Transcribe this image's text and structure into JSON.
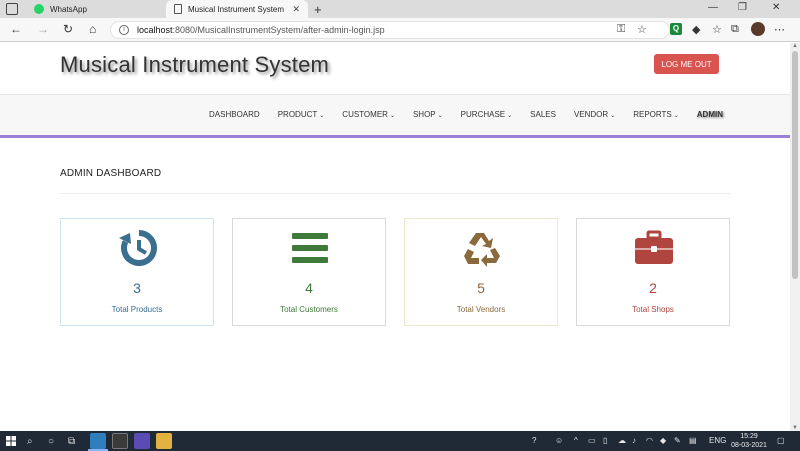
{
  "browser": {
    "tabs": [
      {
        "title": "WhatsApp",
        "active": false
      },
      {
        "title": "Musical Instrument System",
        "active": true
      }
    ],
    "tab_close": "✕",
    "new_tab": "+",
    "window_controls": [
      "—",
      "❐",
      "✕"
    ],
    "url_host": "localhost",
    "url_path": ":8080/MusicalInstrumentSystem/after-admin-login.jsp",
    "extension_label": "Q"
  },
  "site": {
    "title": "Musical Instrument System",
    "logout_label": "LOG ME OUT",
    "nav": [
      {
        "label": "DASHBOARD",
        "dropdown": false
      },
      {
        "label": "PRODUCT",
        "dropdown": true
      },
      {
        "label": "CUSTOMER",
        "dropdown": true
      },
      {
        "label": "SHOP",
        "dropdown": true
      },
      {
        "label": "PURCHASE",
        "dropdown": true
      },
      {
        "label": "SALES",
        "dropdown": false
      },
      {
        "label": "VENDOR",
        "dropdown": true
      },
      {
        "label": "REPORTS",
        "dropdown": true
      },
      {
        "label": "ADMIN",
        "dropdown": false
      }
    ],
    "nav_chevron": "⌄",
    "dashboard_title": "ADMIN DASHBOARD",
    "cards": [
      {
        "icon": "history-icon",
        "value": "3",
        "label": "Total Products",
        "color": "#3a6f8f",
        "border": "#cfe3ee"
      },
      {
        "icon": "bars-icon",
        "value": "4",
        "label": "Total Customers",
        "color": "#3f7a3a",
        "border": "#d9d9d9"
      },
      {
        "icon": "recycle-icon",
        "value": "5",
        "label": "Total Vendors",
        "color": "#8a6a3c",
        "border": "#efe6d4"
      },
      {
        "icon": "briefcase-icon",
        "value": "2",
        "label": "Total Shops",
        "color": "#b0453f",
        "border": "#d9d9d9"
      }
    ],
    "accent_color": "#9b7fd4",
    "logout_color": "#d9534f"
  },
  "taskbar": {
    "language": "ENG",
    "time": "15:29",
    "date": "08-03-2021"
  }
}
